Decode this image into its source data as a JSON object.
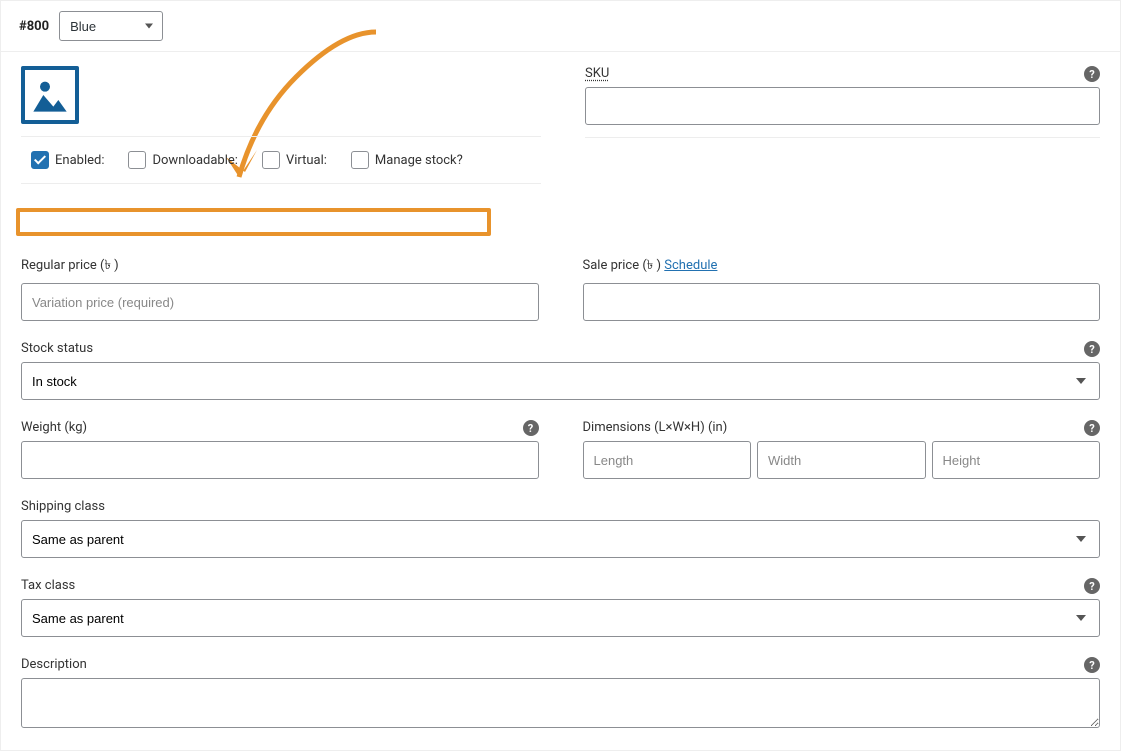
{
  "header": {
    "id_label": "#800",
    "attribute_selected": "Blue"
  },
  "checkboxes": {
    "enabled": {
      "label": "Enabled:",
      "checked": true
    },
    "downloadable": {
      "label": "Downloadable:",
      "checked": false
    },
    "virtual": {
      "label": "Virtual:",
      "checked": false
    },
    "manage_stock": {
      "label": "Manage stock?",
      "checked": false
    }
  },
  "sku": {
    "label": "SKU",
    "value": ""
  },
  "regular_price": {
    "label": "Regular price (৳ )",
    "placeholder": "Variation price (required)",
    "value": ""
  },
  "sale_price": {
    "label": "Sale price (৳ )",
    "schedule_link": "Schedule",
    "value": ""
  },
  "stock_status": {
    "label": "Stock status",
    "selected": "In stock"
  },
  "weight": {
    "label": "Weight (kg)",
    "value": ""
  },
  "dimensions": {
    "label": "Dimensions (L×W×H) (in)",
    "length": {
      "placeholder": "Length",
      "value": ""
    },
    "width": {
      "placeholder": "Width",
      "value": ""
    },
    "height": {
      "placeholder": "Height",
      "value": ""
    }
  },
  "shipping_class": {
    "label": "Shipping class",
    "selected": "Same as parent"
  },
  "tax_class": {
    "label": "Tax class",
    "selected": "Same as parent"
  },
  "description": {
    "label": "Description",
    "value": ""
  },
  "help_glyph": "?"
}
